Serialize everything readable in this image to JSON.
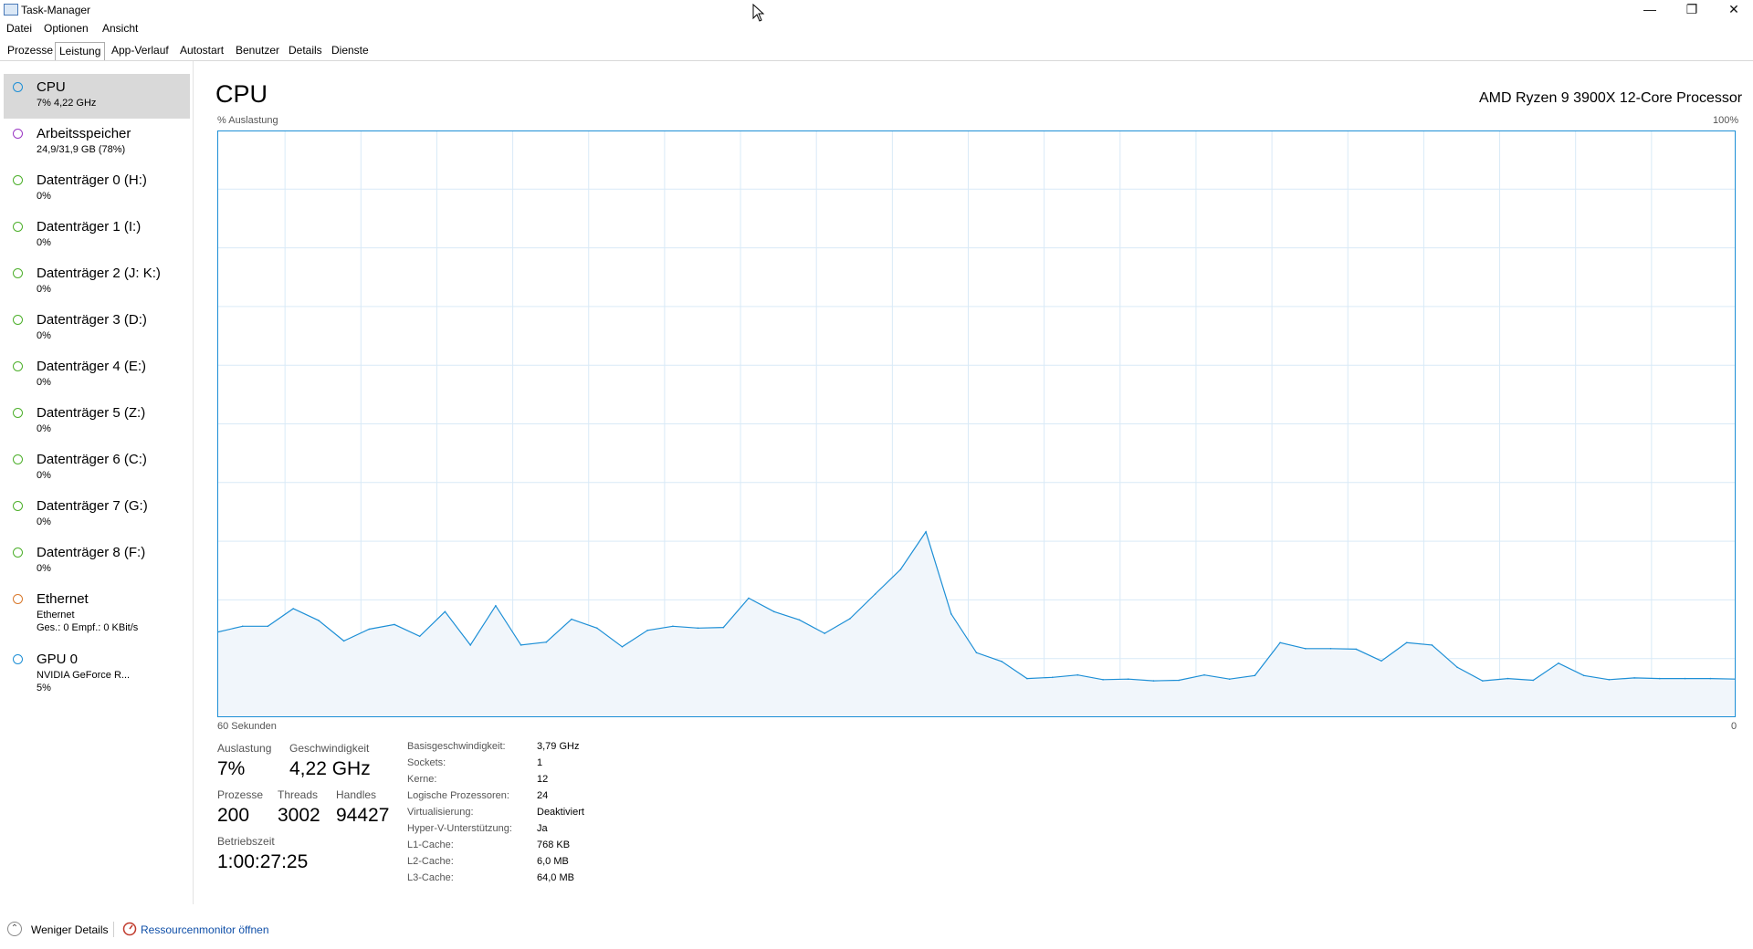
{
  "window": {
    "title": "Task-Manager",
    "minimize": "—",
    "maximize": "❐",
    "close": "✕"
  },
  "menu": [
    "Datei",
    "Optionen",
    "Ansicht"
  ],
  "tabs": [
    "Prozesse",
    "Leistung",
    "App-Verlauf",
    "Autostart",
    "Benutzer",
    "Details",
    "Dienste"
  ],
  "active_tab": "Leistung",
  "sidebar": [
    {
      "name": "CPU",
      "sub": "7% 4,22 GHz",
      "sub2": "",
      "color": "#1d8fd6",
      "selected": true
    },
    {
      "name": "Arbeitsspeicher",
      "sub": "24,9/31,9 GB (78%)",
      "sub2": "",
      "color": "#9b38c4",
      "selected": false
    },
    {
      "name": "Datenträger 0 (H:)",
      "sub": "0%",
      "sub2": "",
      "color": "#4caf2a",
      "selected": false
    },
    {
      "name": "Datenträger 1 (I:)",
      "sub": "0%",
      "sub2": "",
      "color": "#4caf2a",
      "selected": false
    },
    {
      "name": "Datenträger 2 (J: K:)",
      "sub": "0%",
      "sub2": "",
      "color": "#4caf2a",
      "selected": false
    },
    {
      "name": "Datenträger 3 (D:)",
      "sub": "0%",
      "sub2": "",
      "color": "#4caf2a",
      "selected": false
    },
    {
      "name": "Datenträger 4 (E:)",
      "sub": "0%",
      "sub2": "",
      "color": "#4caf2a",
      "selected": false
    },
    {
      "name": "Datenträger 5 (Z:)",
      "sub": "0%",
      "sub2": "",
      "color": "#4caf2a",
      "selected": false
    },
    {
      "name": "Datenträger 6 (C:)",
      "sub": "0%",
      "sub2": "",
      "color": "#4caf2a",
      "selected": false
    },
    {
      "name": "Datenträger 7 (G:)",
      "sub": "0%",
      "sub2": "",
      "color": "#4caf2a",
      "selected": false
    },
    {
      "name": "Datenträger 8 (F:)",
      "sub": "0%",
      "sub2": "",
      "color": "#4caf2a",
      "selected": false
    },
    {
      "name": "Ethernet",
      "sub": "Ethernet",
      "sub2": "Ges.: 0 Empf.: 0 KBit/s",
      "color": "#d9782b",
      "selected": false
    },
    {
      "name": "GPU 0",
      "sub": "NVIDIA GeForce R...",
      "sub2": "5%",
      "color": "#1d8fd6",
      "selected": false
    }
  ],
  "main": {
    "title": "CPU",
    "processor": "AMD Ryzen 9 3900X 12-Core Processor",
    "y_label": "% Auslastung",
    "y_max_label": "100%",
    "x_label": "60 Sekunden",
    "x_end_label": "0"
  },
  "chart_data": {
    "type": "area",
    "ylabel": "% Auslastung",
    "ylim": [
      0,
      100
    ],
    "xlabel": "60 Sekunden",
    "xlim": [
      60,
      0
    ],
    "grid": true,
    "color": "#1d8fd6",
    "x": [
      60,
      59,
      58,
      57,
      56,
      55,
      54,
      53,
      52,
      51,
      50,
      49,
      48,
      47,
      46,
      45,
      44,
      43,
      42,
      41,
      40,
      39,
      38,
      37,
      36,
      35,
      34,
      33,
      32,
      31,
      30,
      29,
      28,
      27,
      26,
      25,
      24,
      23,
      22,
      21,
      20,
      19,
      18,
      17,
      16,
      15,
      14,
      13,
      12,
      11,
      10,
      9,
      8,
      7,
      6,
      5,
      4,
      3,
      2,
      1,
      0
    ],
    "values": [
      14.5,
      15.5,
      15.5,
      18.5,
      16.5,
      13,
      15,
      15.8,
      13.8,
      18,
      12.3,
      19,
      12.3,
      12.8,
      16.7,
      15.2,
      12,
      14.8,
      15.5,
      15.2,
      15.3,
      20.3,
      18,
      16.6,
      14.3,
      16.8,
      21,
      25.2,
      31.6,
      17.6,
      11,
      9.5,
      6.6,
      6.8,
      7.2,
      6.4,
      6.5,
      6.2,
      6.3,
      7.2,
      6.5,
      7.1,
      12.7,
      11.7,
      11.7,
      11.6,
      9.6,
      12.7,
      12.3,
      8.5,
      6.2,
      6.6,
      6.3,
      9.2,
      7.1,
      6.4,
      6.7,
      6.6,
      6.6,
      6.6,
      6.5
    ]
  },
  "stats": {
    "utilization_label": "Auslastung",
    "utilization": "7%",
    "speed_label": "Geschwindigkeit",
    "speed": "4,22 GHz",
    "processes_label": "Prozesse",
    "processes": "200",
    "threads_label": "Threads",
    "threads": "3002",
    "handles_label": "Handles",
    "handles": "94427",
    "uptime_label": "Betriebszeit",
    "uptime": "1:00:27:25"
  },
  "specs": [
    {
      "label": "Basisgeschwindigkeit:",
      "value": "3,79 GHz"
    },
    {
      "label": "Sockets:",
      "value": "1"
    },
    {
      "label": "Kerne:",
      "value": "12"
    },
    {
      "label": "Logische Prozessoren:",
      "value": "24"
    },
    {
      "label": "Virtualisierung:",
      "value": "Deaktiviert"
    },
    {
      "label": "Hyper-V-Unterstützung:",
      "value": "Ja"
    },
    {
      "label": "L1-Cache:",
      "value": "768 KB"
    },
    {
      "label": "L2-Cache:",
      "value": "6,0 MB"
    },
    {
      "label": "L3-Cache:",
      "value": "64,0 MB"
    }
  ],
  "footer": {
    "fewer_details": "Weniger Details",
    "resource_monitor": "Ressourcenmonitor öffnen"
  }
}
